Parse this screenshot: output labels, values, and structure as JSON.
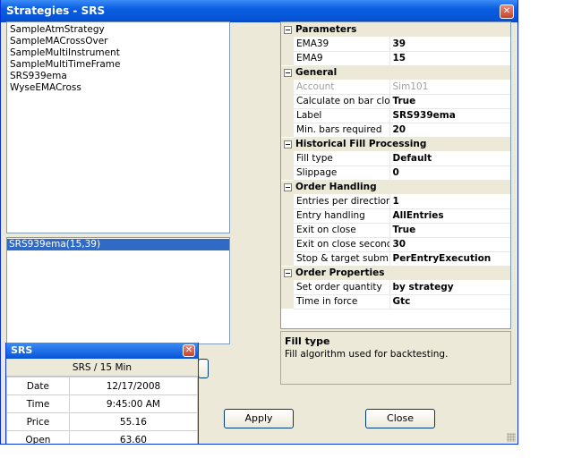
{
  "window": {
    "title": "Strategies - SRS",
    "close_glyph": "✕"
  },
  "strategies": [
    "SampleAtmStrategy",
    "SampleMACrossOver",
    "SampleMultiInstrument",
    "SampleMultiTimeFrame",
    "SRS939ema",
    "WyseEMACross"
  ],
  "configured": [
    "SRS939ema(15,39)"
  ],
  "properties": {
    "parameters": {
      "title": "Parameters",
      "rows": [
        {
          "name": "EMA39",
          "value": "39"
        },
        {
          "name": "EMA9",
          "value": "15"
        }
      ]
    },
    "general": {
      "title": "General",
      "rows": [
        {
          "name": "Account",
          "value": "Sim101"
        },
        {
          "name": "Calculate on bar clos",
          "value": "True"
        },
        {
          "name": "Label",
          "value": "SRS939ema"
        },
        {
          "name": "Min. bars required",
          "value": "20"
        }
      ]
    },
    "fill": {
      "title": "Historical Fill Processing",
      "rows": [
        {
          "name": "Fill type",
          "value": "Default"
        },
        {
          "name": "Slippage",
          "value": "0"
        }
      ]
    },
    "order": {
      "title": "Order Handling",
      "rows": [
        {
          "name": "Entries per direction",
          "value": "1"
        },
        {
          "name": "Entry handling",
          "value": "AllEntries"
        },
        {
          "name": "Exit on close",
          "value": "True"
        },
        {
          "name": "Exit on close second",
          "value": "30"
        },
        {
          "name": "Stop & target submis",
          "value": "PerEntryExecution"
        }
      ]
    },
    "props": {
      "title": "Order Properties",
      "rows": [
        {
          "name": "Set order quantity",
          "value": "by strategy"
        },
        {
          "name": "Time in force",
          "value": "Gtc"
        }
      ]
    },
    "collapse_glyph": "−"
  },
  "help": {
    "title": "Fill type",
    "description": "Fill algorithm used for backtesting."
  },
  "buttons": {
    "apply": "Apply",
    "close": "Close"
  },
  "data_window": {
    "title": "SRS",
    "header": "SRS / 15 Min",
    "rows": [
      {
        "label": "Date",
        "value": "12/17/2008"
      },
      {
        "label": "Time",
        "value": "9:45:00 AM"
      },
      {
        "label": "Price",
        "value": "55.16"
      },
      {
        "label": "Open",
        "value": "63.60"
      }
    ]
  }
}
